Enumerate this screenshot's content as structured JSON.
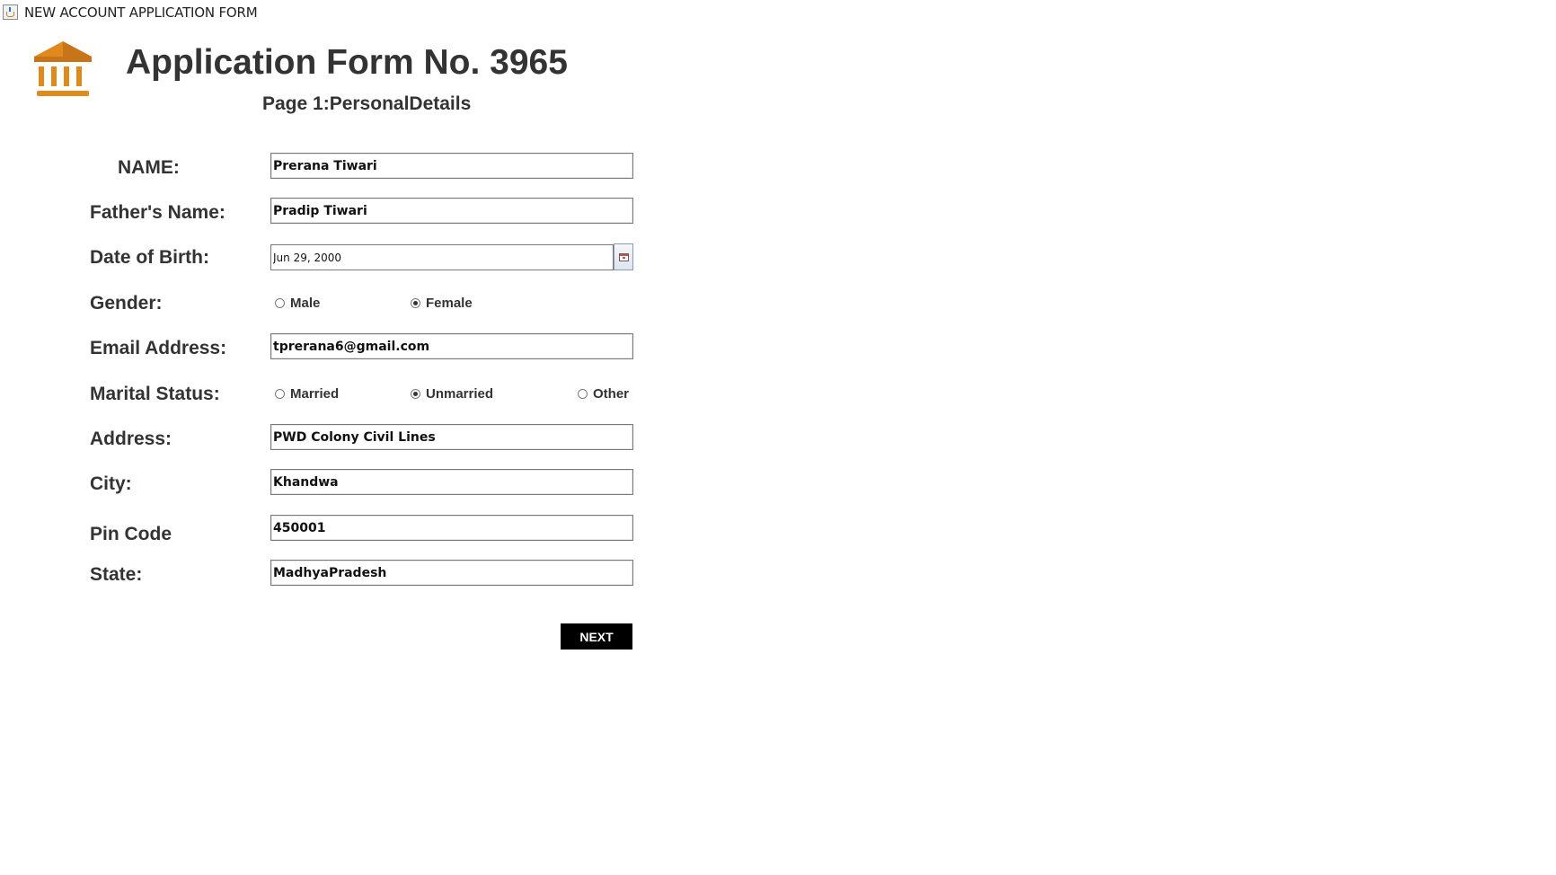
{
  "window": {
    "title": "NEW ACCOUNT APPLICATION FORM"
  },
  "header": {
    "form_title": "Application Form No. 3965",
    "page_subtitle": "Page 1:PersonalDetails",
    "logo_icon": "bank-building-icon",
    "logo_color": "#E08A1E"
  },
  "fields": {
    "name": {
      "label": "NAME:",
      "value": "Prerana Tiwari"
    },
    "father_name": {
      "label": "Father's Name:",
      "value": "Pradip Tiwari"
    },
    "dob": {
      "label": "Date of Birth:",
      "value": "Jun 29, 2000",
      "button_icon": "calendar-icon"
    },
    "gender": {
      "label": "Gender:",
      "options": [
        {
          "label": "Male",
          "checked": false
        },
        {
          "label": "Female",
          "checked": true
        }
      ]
    },
    "email": {
      "label": "Email Address:",
      "value": "tprerana6@gmail.com"
    },
    "marital_status": {
      "label": "Marital Status:",
      "options": [
        {
          "label": "Married",
          "checked": false
        },
        {
          "label": "Unmarried",
          "checked": true
        },
        {
          "label": "Other",
          "checked": false
        }
      ]
    },
    "address": {
      "label": "Address:",
      "value": "PWD Colony Civil Lines"
    },
    "city": {
      "label": "City:",
      "value": "Khandwa"
    },
    "pin_code": {
      "label": "Pin Code",
      "value": "450001"
    },
    "state": {
      "label": "State:",
      "value": "MadhyaPradesh"
    }
  },
  "actions": {
    "next_label": "NEXT",
    "next_bg": "#000000",
    "next_fg": "#FFFFFF"
  }
}
